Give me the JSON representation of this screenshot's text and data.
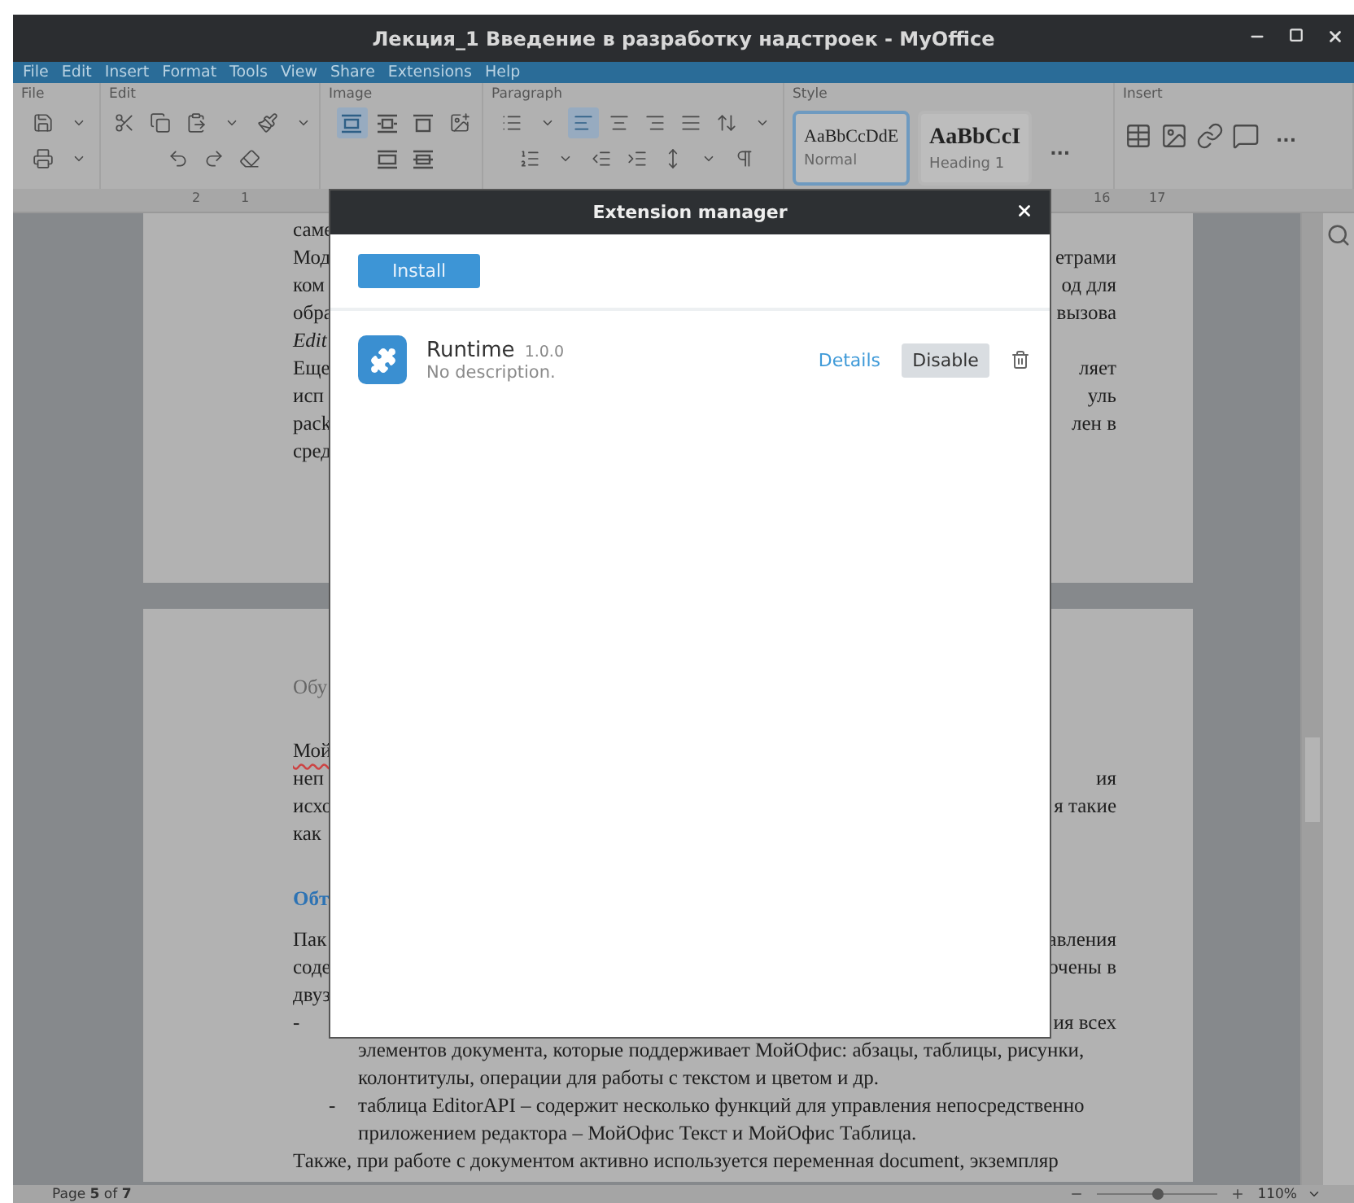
{
  "window": {
    "title": "Лекция_1 Введение в разработку надстроек - MyOffice"
  },
  "menu": [
    "File",
    "Edit",
    "Insert",
    "Format",
    "Tools",
    "View",
    "Share",
    "Extensions",
    "Help"
  ],
  "toolbar": [
    {
      "label": "File",
      "rows": [
        [
          {
            "selected": false
          },
          {
            "selected": false
          }
        ],
        [
          {
            "selected": false
          },
          {
            "selected": false
          }
        ]
      ]
    },
    {
      "label": "Edit",
      "rows": [
        [
          {
            "selected": false
          },
          {
            "selected": false
          },
          {
            "selected": false
          },
          {
            "selected": false
          },
          {
            "selected": false
          },
          {
            "selected": false
          }
        ],
        [
          {
            "selected": false
          },
          {
            "selected": false
          },
          {
            "selected": false
          }
        ]
      ]
    },
    {
      "label": "Image",
      "rows": [
        [
          {
            "selected": true
          },
          {
            "selected": false
          },
          {
            "selected": false
          },
          {
            "selected": false
          }
        ],
        [
          {
            "selected": false
          },
          {
            "selected": false
          }
        ]
      ]
    },
    {
      "label": "Paragraph",
      "rows": [
        [
          {
            "selected": false
          },
          {
            "selected": false
          },
          {
            "selected": true
          },
          {
            "selected": false
          },
          {
            "selected": false
          },
          {
            "selected": false
          },
          {
            "selected": false
          },
          {
            "selected": false
          }
        ],
        [
          {
            "selected": false
          },
          {
            "selected": false
          },
          {
            "selected": false
          },
          {
            "selected": false
          },
          {
            "selected": false
          },
          {
            "selected": false
          },
          {
            "selected": false
          }
        ]
      ]
    },
    {
      "label": "Style",
      "styles": [
        {
          "sample": "AaBbCcDdE",
          "name": "Normal",
          "kind": "normal",
          "selected": true
        },
        {
          "sample": "AaBbCcI",
          "name": "Heading 1",
          "kind": "heading",
          "selected": false
        }
      ],
      "more": "..."
    },
    {
      "label": "Insert",
      "rows": [
        [
          {
            "selected": false
          },
          {
            "selected": false
          },
          {
            "selected": false
          },
          {
            "selected": false
          }
        ]
      ],
      "more": "..."
    }
  ],
  "ruler": {
    "labels": [
      "2",
      "1",
      "16",
      "17"
    ]
  },
  "pages": [
    {
      "lines": [
        {
          "kind": "split",
          "left": "саме"
        },
        {
          "kind": "split",
          "left": "Мод",
          "right": "етрами"
        },
        {
          "kind": "split",
          "left": "ком",
          "right": "од для"
        },
        {
          "kind": "split",
          "left": "обра",
          "right": "вызова"
        },
        {
          "kind": "italic",
          "left": "Edit"
        },
        {
          "kind": "split",
          "left": "Еще",
          "right": "ляет"
        },
        {
          "kind": "split",
          "left": "исп",
          "right": "уль"
        },
        {
          "kind": "split",
          "left": "pack",
          "right": "лен в"
        },
        {
          "kind": "split",
          "left": "сред"
        }
      ]
    },
    {
      "lines": [
        {
          "kind": "title",
          "left": "Обу"
        },
        {
          "kind": "misspelled",
          "left": "Мой"
        },
        {
          "kind": "split",
          "left": "неп",
          "right": "ия"
        },
        {
          "kind": "split",
          "left": "исхо",
          "right": "я такие"
        },
        {
          "kind": "split",
          "left": "как"
        },
        {
          "kind": "heading",
          "left": "Обт"
        },
        {
          "kind": "split",
          "left": "Пак",
          "right": "авления"
        },
        {
          "kind": "split",
          "left": "соде",
          "right": "очены в"
        },
        {
          "kind": "split",
          "left": "двуз"
        },
        {
          "kind": "split",
          "left": "-",
          "right": "ия  всех"
        },
        {
          "kind": "continuation",
          "text": "элементов документа, которые поддерживает МойОфис: абзацы, таблицы, рисунки,"
        },
        {
          "kind": "continuation",
          "text": "колонтитулы, операции для работы с текстом и цветом и др."
        },
        {
          "kind": "bullet",
          "marker": "-",
          "text": "таблица EditorAPI – содержит несколько функций для управления непосредственно"
        },
        {
          "kind": "continuation",
          "text": "приложением редактора – МойОфис Текст и МойОфис Таблица."
        },
        {
          "kind": "full",
          "text": "Также, при работе с документом активно используется переменная document, экземпляр"
        }
      ]
    }
  ],
  "dialog": {
    "title": "Extension manager",
    "install": "Install",
    "extensions": [
      {
        "name": "Runtime",
        "version": "1.0.0",
        "description": "No description.",
        "details": "Details",
        "toggle": "Disable"
      }
    ]
  },
  "status_bar": {
    "page": "Page **5** of **7**",
    "zoom": {
      "level": 0.5,
      "value": "110%"
    }
  }
}
